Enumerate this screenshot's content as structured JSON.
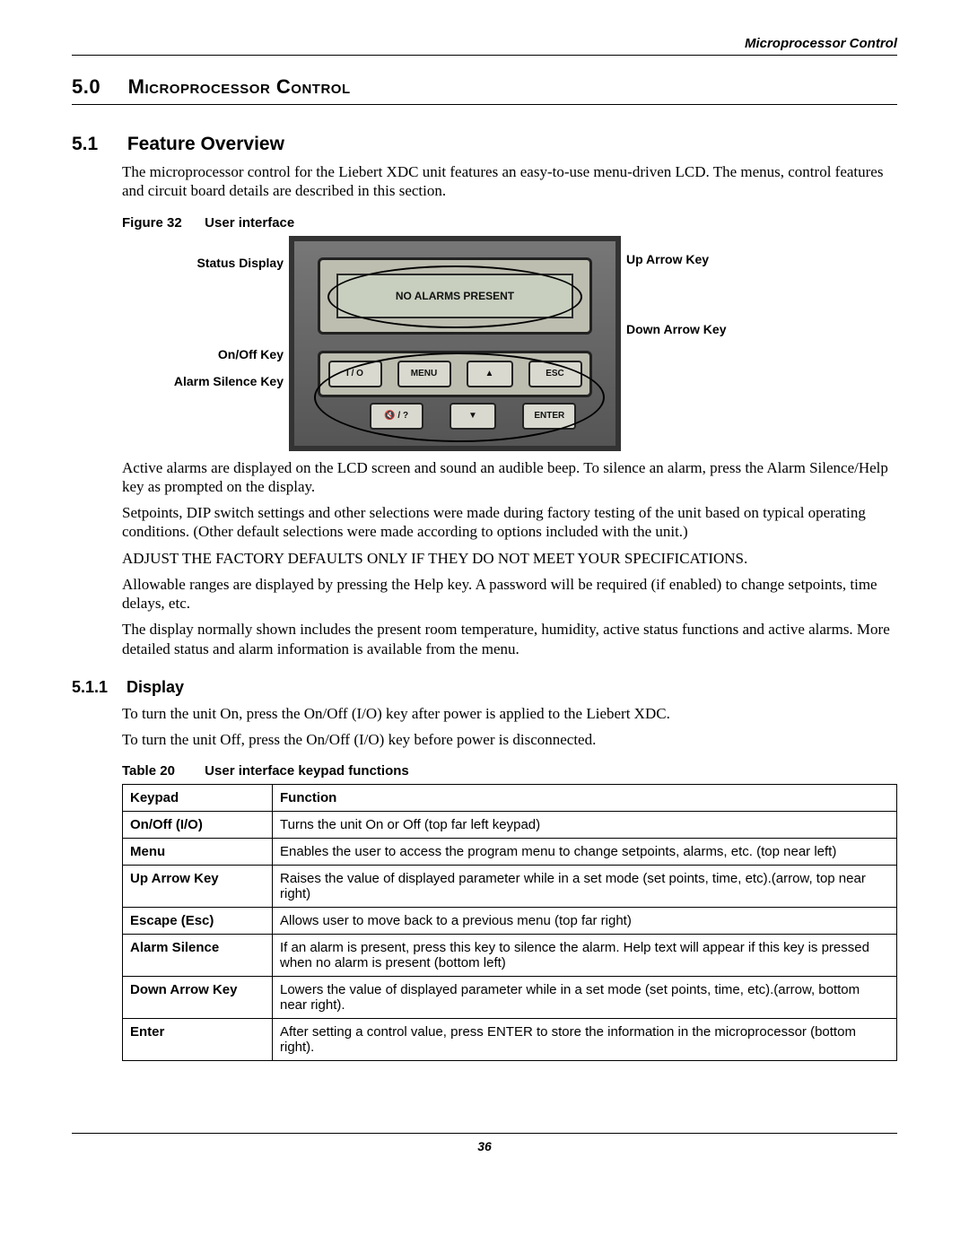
{
  "running_head": "Microprocessor Control",
  "section": {
    "num": "5.0",
    "title": "Microprocessor Control"
  },
  "subsection": {
    "num": "5.1",
    "title": "Feature Overview"
  },
  "intro_para": "The microprocessor control for the Liebert XDC unit features an easy-to-use menu-driven LCD. The menus, control features and circuit board details are described in this section.",
  "figure": {
    "label": "Figure 32",
    "caption": "User interface",
    "lcd_text": "NO ALARMS PRESENT",
    "left_labels": {
      "status_display": "Status Display",
      "on_off": "On/Off Key",
      "alarm_silence": "Alarm Silence Key"
    },
    "right_labels": {
      "up_arrow": "Up Arrow Key",
      "down_arrow": "Down Arrow Key"
    },
    "buttons": {
      "io": "I / O",
      "menu": "MENU",
      "up": "▲",
      "esc": "ESC",
      "silence": "🔇 / ?",
      "down": "▼",
      "enter": "ENTER"
    }
  },
  "paras": {
    "p2": "Active alarms are displayed on the LCD screen and sound an audible beep. To silence an alarm, press the Alarm Silence/Help key as prompted on the display.",
    "p3": "Setpoints, DIP switch settings and other selections were made during factory testing of the unit based on typical operating conditions. (Other default selections were made according to options included with the unit.)",
    "p4": "ADJUST THE FACTORY DEFAULTS ONLY IF THEY DO NOT MEET YOUR SPECIFICATIONS.",
    "p5": "Allowable ranges are displayed by pressing the Help key. A password will be required (if enabled) to change setpoints, time delays, etc.",
    "p6": "The display normally shown includes the present room temperature, humidity, active status functions and active alarms. More detailed status and alarm information is available from the menu."
  },
  "subsub": {
    "num": "5.1.1",
    "title": "Display"
  },
  "display_paras": {
    "d1": "To turn the unit On, press the On/Off (I/O) key after power is applied to the Liebert XDC.",
    "d2": "To turn the unit Off, press the On/Off (I/O) key before power is disconnected."
  },
  "table": {
    "label": "Table 20",
    "caption": "User interface keypad functions",
    "headers": {
      "c1": "Keypad",
      "c2": "Function"
    },
    "rows": [
      {
        "k": "On/Off (I/O)",
        "f": "Turns the unit On or Off (top far left keypad)"
      },
      {
        "k": "Menu",
        "f": "Enables the user to access the program menu to change setpoints, alarms, etc. (top near left)"
      },
      {
        "k": "Up Arrow Key",
        "f": "Raises the value of displayed parameter while in a set mode (set points, time, etc).(arrow, top near right)"
      },
      {
        "k": "Escape (Esc)",
        "f": "Allows user to move back to a previous menu (top far right)"
      },
      {
        "k": "Alarm Silence",
        "f": "If an alarm is present, press this key to silence the alarm. Help text will appear if this key is pressed when no alarm is present (bottom left)"
      },
      {
        "k": "Down Arrow Key",
        "f": "Lowers the value of displayed parameter while in a set mode (set points, time, etc).(arrow, bottom near right)."
      },
      {
        "k": "Enter",
        "f": "After setting a control value, press ENTER to store the information in the microprocessor (bottom right)."
      }
    ]
  },
  "page_number": "36"
}
